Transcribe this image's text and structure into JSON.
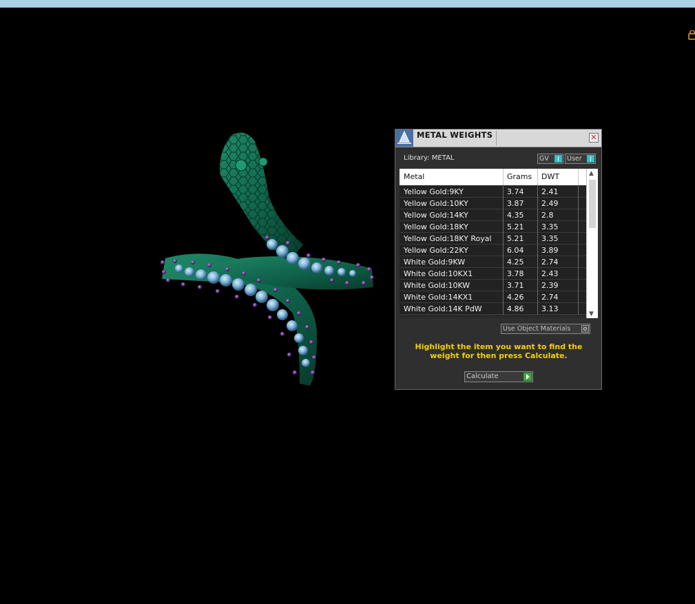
{
  "panel": {
    "title": "METAL WEIGHTS",
    "library_label": "Library: METAL",
    "toggles": {
      "gv_label": "GV",
      "user_label": "User"
    },
    "table": {
      "headers": [
        "Metal",
        "Grams",
        "DWT"
      ],
      "rows": [
        {
          "metal": "Yellow Gold:9KY",
          "grams": "3.74",
          "dwt": "2.41"
        },
        {
          "metal": "Yellow Gold:10KY",
          "grams": "3.87",
          "dwt": "2.49"
        },
        {
          "metal": "Yellow Gold:14KY",
          "grams": "4.35",
          "dwt": "2.8"
        },
        {
          "metal": "Yellow Gold:18KY",
          "grams": "5.21",
          "dwt": "3.35"
        },
        {
          "metal": "Yellow Gold:18KY Royal",
          "grams": "5.21",
          "dwt": "3.35"
        },
        {
          "metal": "Yellow Gold:22KY",
          "grams": "6.04",
          "dwt": "3.89"
        },
        {
          "metal": "White Gold:9KW",
          "grams": "4.25",
          "dwt": "2.74"
        },
        {
          "metal": "White Gold:10KX1",
          "grams": "3.78",
          "dwt": "2.43"
        },
        {
          "metal": "White Gold:10KW",
          "grams": "3.71",
          "dwt": "2.39"
        },
        {
          "metal": "White Gold:14KX1",
          "grams": "4.26",
          "dwt": "2.74"
        },
        {
          "metal": "White Gold:14K PdW",
          "grams": "4.86",
          "dwt": "3.13"
        }
      ]
    },
    "use_object_materials_label": "Use Object Materials",
    "hint_text": "Highlight the item you want to find the weight for then press Calculate.",
    "calculate_label": "Calculate"
  },
  "colors": {
    "hint": "#f3d000",
    "ring_metal": "#0f5e47",
    "gem_blue": "#7fb5d8",
    "gem_purple": "#6b1fa0",
    "toggle_on": "#3fb8c4",
    "calculate_play": "#3aa53a"
  },
  "icons": {
    "title_icon": "scale-icon",
    "close_icon": "close-icon",
    "corner_icon": "lock-icon"
  }
}
